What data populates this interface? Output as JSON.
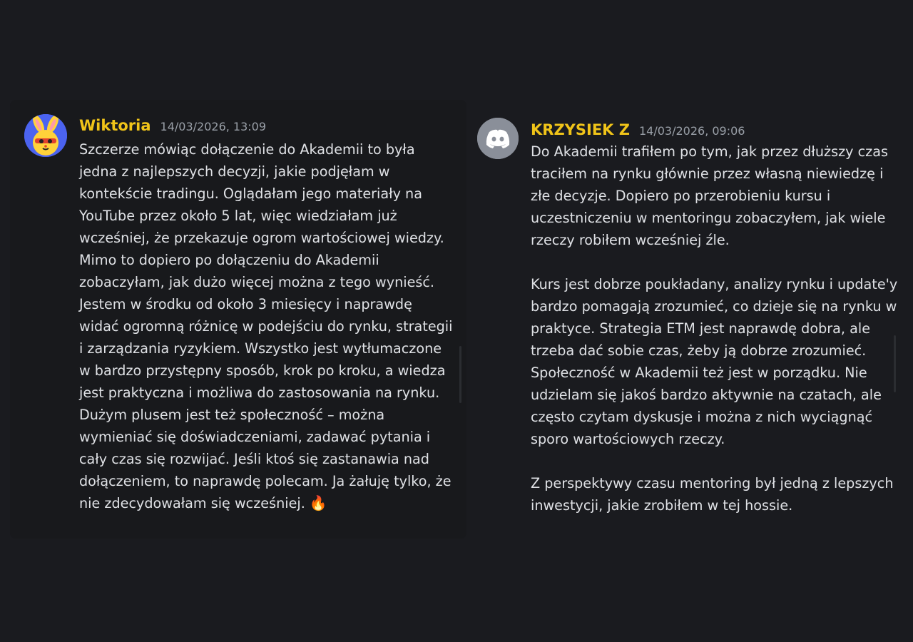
{
  "messages": [
    {
      "username": "Wiktoria",
      "timestamp": "14/03/2026, 13:09",
      "avatar_icon": "yellow-rabbit-avatar",
      "text": "Szczerze mówiąc dołączenie do Akademii to była jedna z najlepszych decyzji, jakie podjęłam w kontekście tradingu. Oglądałam jego materiały na YouTube przez około 5 lat, więc wiedziałam już wcześniej, że przekazuje ogrom wartościowej wiedzy. Mimo to dopiero po dołączeniu do Akademii zobaczyłam, jak dużo więcej można z tego wynieść. Jestem w środku od około 3 miesięcy i naprawdę widać ogromną różnicę w podejściu do rynku, strategii i zarządzania ryzykiem. Wszystko jest wytłumaczone w bardzo przystępny sposób, krok po kroku, a wiedza jest praktyczna i możliwa do zastosowania na rynku.\nDużym plusem jest też społeczność – można wymieniać się doświadczeniami, zadawać pytania i cały czas się rozwijać. Jeśli ktoś się zastanawia nad dołączeniem, to naprawdę polecam. Ja żałuję tylko, że nie zdecydowałam się wcześniej.",
      "emoji": "🔥"
    },
    {
      "username": "KRZYSIEK Z",
      "timestamp": "14/03/2026, 09:06",
      "avatar_icon": "discord-logo-icon",
      "text": "Do Akademii trafiłem po tym, jak przez dłuższy czas traciłem na rynku głównie przez własną niewiedzę i złe decyzje. Dopiero po przerobieniu kursu i uczestniczeniu w mentoringu zobaczyłem, jak wiele rzeczy robiłem wcześniej źle.\n\nKurs jest dobrze poukładany, analizy rynku i update'y bardzo pomagają zrozumieć, co dzieje się na rynku w praktyce. Strategia ETM jest naprawdę dobra, ale trzeba dać sobie czas, żeby ją dobrze zrozumieć.\nSpołeczność w Akademii też jest w porządku. Nie udzielam się jakoś bardzo aktywnie na czatach, ale często czytam dyskusje i można z nich wyciągnąć sporo wartościowych rzeczy.\n\nZ perspektywy czasu mentoring był jedną z lepszych inwestycji, jakie zrobiłem w tej hossie."
    }
  ]
}
